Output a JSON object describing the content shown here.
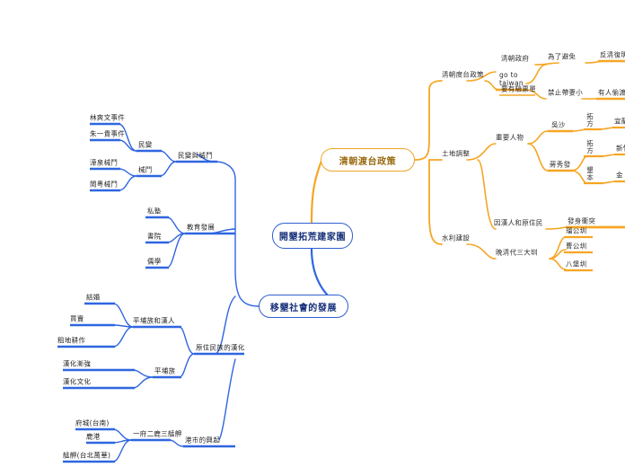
{
  "diagram": {
    "type": "mind-map",
    "title": "開墾拓荒建家園",
    "colors": {
      "root_border": "#2f5fd0",
      "blue_branch": "#2f66e0",
      "orange_branch": "#f5a623",
      "orange_fade": "#fce3bd",
      "blue_text": "#16307a",
      "orange_text": "#9a6a10",
      "leaf_text": "#2d2d2d",
      "background": "#ffffff"
    },
    "root": {
      "label": "開墾拓荒建家園"
    },
    "branches": {
      "qing_policy": {
        "label": "清朝渡台政策",
        "color": "orange"
      },
      "migrant_society": {
        "label": "移墾社會的發展",
        "color": "blue"
      }
    },
    "orange_nodes": {
      "policy_root": "清朝度台政策",
      "go_to_taiwan": "go to taiwan",
      "qing_government": "清朝政府",
      "to_avoid": "為了避免",
      "anti_qing": "反清復明",
      "need_ticket": "要有驗票單",
      "no_family": "禁止帶妻小",
      "someone_smuggle": "有人偷渡",
      "land_adjust": "土地調整",
      "key_people": "重要人物",
      "wu_sha": "吳沙",
      "jiang_xiufeng": "蔣秀發",
      "kai_fang_1": "拓方",
      "kai_fang_2": "拓方",
      "ken_2": "墾本",
      "yilan": "宜蘭",
      "xinzhu": "新竹",
      "jin": "金",
      "han_vs_native": "因漢人和原住民",
      "conflict": "發身衝突",
      "water_works": "水利建設",
      "three_canals": "晚清代三大圳",
      "liugong": "瑠公圳",
      "caogong": "曹公圳",
      "babao": "八堡圳"
    },
    "blue_nodes": {
      "riot_and_fight": "民變與械鬥",
      "riot": "民變",
      "lin_shuangwen": "林爽文事件",
      "zhu_yigui": "朱一貴事件",
      "fight": "械鬥",
      "zhang_quan": "漳泉械鬥",
      "min_yue": "閩粵械鬥",
      "education": "教育發展",
      "private_school": "私塾",
      "academy": "書院",
      "confucian": "儒學",
      "native_sinicization": "原住民族的漢化",
      "pingpu_and_han": "平埔族和漢人",
      "marriage": "結婚",
      "trade": "買賣",
      "rent_farm": "租地耕作",
      "pingpu": "平埔族",
      "sinicize_strong": "漢化漸強",
      "sinicize_culture": "漢化文化",
      "port_rise": "港市的興起",
      "one_fu_two_lu": "一府二鹿三艋舺",
      "fucheng": "府城(台南)",
      "lugang": "鹿港",
      "mengjia": "艋舺(台北萬華)"
    }
  }
}
